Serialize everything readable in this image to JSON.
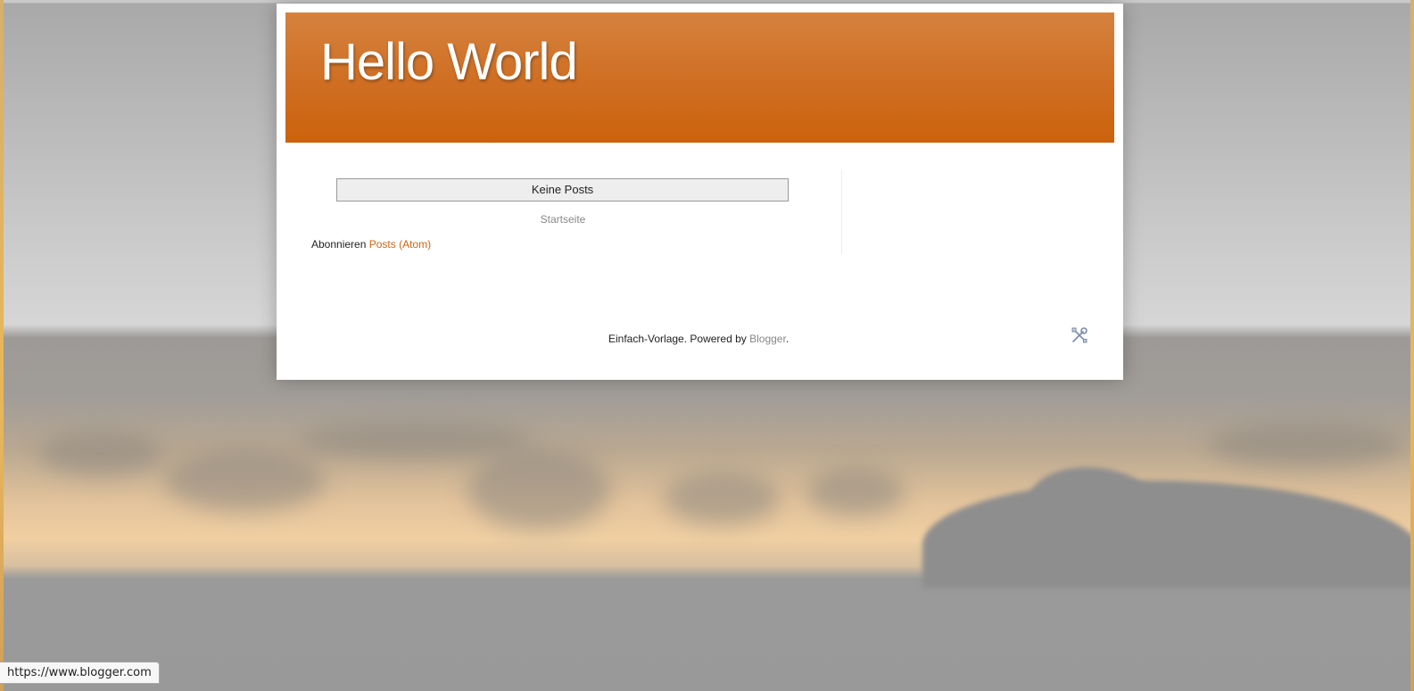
{
  "blog": {
    "title": "Hello World"
  },
  "main": {
    "no_posts_label": "Keine Posts",
    "home_link": "Startseite",
    "subscribe_prefix": "Abonnieren",
    "subscribe_link": "Posts (Atom)"
  },
  "footer": {
    "attribution_prefix": "Einfach-Vorlage. Powered by",
    "attribution_link": "Blogger",
    "attribution_suffix": ".",
    "tools_icon": "wrench-screwdriver-icon"
  },
  "status_bar": {
    "url": "https://www.blogger.com"
  },
  "colors": {
    "header_top": "#d5823f",
    "header_bottom": "#cb620c",
    "link": "#cc6611"
  }
}
